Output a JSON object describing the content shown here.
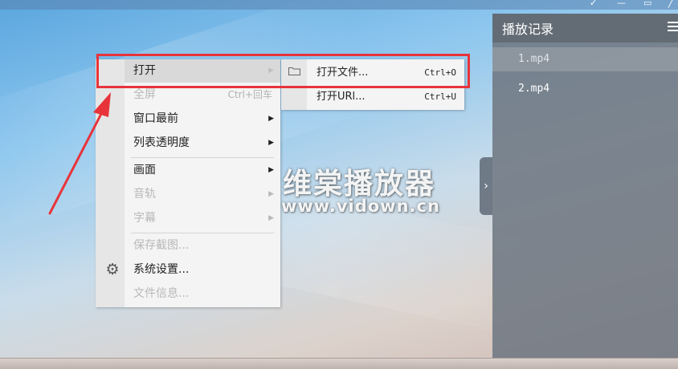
{
  "watermark": {
    "title": "维棠播放器",
    "url": "www.vidown.cn"
  },
  "history_panel": {
    "title": "播放记录",
    "items": [
      {
        "label": "1.mp4",
        "selected": true
      },
      {
        "label": "2.mp4",
        "selected": false
      }
    ]
  },
  "context_menu": {
    "items": [
      {
        "label": "打开",
        "shortcut": "",
        "arrow": "▶",
        "enabled": true,
        "hover": true
      },
      {
        "label": "全屏",
        "shortcut": "Ctrl+回车",
        "arrow": "",
        "enabled": false
      },
      {
        "label": "窗口最前",
        "shortcut": "",
        "arrow": "▶",
        "enabled": true
      },
      {
        "label": "列表透明度",
        "shortcut": "",
        "arrow": "▶",
        "enabled": true
      },
      {
        "label": "画面",
        "shortcut": "",
        "arrow": "▶",
        "enabled": true
      },
      {
        "label": "音轨",
        "shortcut": "",
        "arrow": "▶",
        "enabled": false
      },
      {
        "label": "字幕",
        "shortcut": "",
        "arrow": "▶",
        "enabled": false
      },
      {
        "label": "保存截图...",
        "shortcut": "",
        "arrow": "",
        "enabled": false
      },
      {
        "label": "系统设置...",
        "shortcut": "",
        "arrow": "",
        "enabled": true
      },
      {
        "label": "文件信息...",
        "shortcut": "",
        "arrow": "",
        "enabled": false
      }
    ]
  },
  "open_submenu": {
    "items": [
      {
        "label": "打开文件...",
        "shortcut": "Ctrl+O"
      },
      {
        "label": "打开URl...",
        "shortcut": "Ctrl+U"
      }
    ]
  },
  "colors": {
    "annotation": "#e8333a",
    "panel_bg": "#707882",
    "menu_bg": "#f4f4f4",
    "menu_hover": "#d9d9d9",
    "disabled_text": "#b8b8b8"
  },
  "icons": {
    "panel_menu": "hamburger-icon",
    "panel_toggle": "chevron-right-icon",
    "settings": "gear-icon",
    "folder": "folder-icon"
  }
}
